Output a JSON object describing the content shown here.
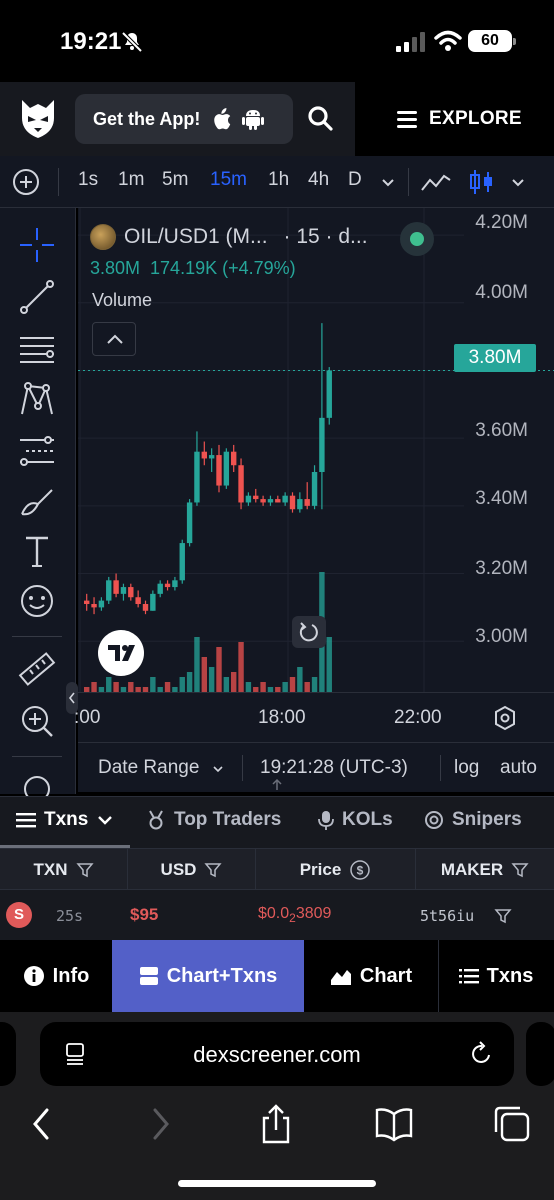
{
  "status_bar": {
    "time": "19:21",
    "battery": "60"
  },
  "header": {
    "get_app_label": "Get the App!",
    "explore_label": "EXPLORE"
  },
  "timeframes": {
    "items": [
      "1s",
      "1m",
      "5m",
      "15m",
      "1h",
      "4h",
      "D"
    ],
    "active": "15m"
  },
  "chart": {
    "symbol": "OIL/USD1 (M...",
    "meta": "· 15 · d...",
    "last_value": "3.80M",
    "change": "174.19K (+4.79%)",
    "volume_label": "Volume",
    "current_price_tag": "3.80M",
    "price_labels": [
      "4.20M",
      "4.00M",
      "3.60M",
      "3.40M",
      "3.20M",
      "3.00M"
    ],
    "time_labels": [
      ":00",
      "18:00",
      "22:00"
    ],
    "colors": {
      "up": "#26a69a",
      "down": "#ef5350",
      "background": "#131722"
    }
  },
  "chart_data": {
    "type": "candlestick",
    "title": "OIL/USD1",
    "ylim": [
      2.85,
      4.28
    ],
    "price_ticks": [
      3.0,
      3.2,
      3.4,
      3.6,
      3.8,
      4.0,
      4.2
    ],
    "time_ticks": [
      ":00",
      "18:00",
      "22:00"
    ],
    "candles": [
      {
        "o": 3.12,
        "h": 3.14,
        "l": 3.09,
        "c": 3.11
      },
      {
        "o": 3.11,
        "h": 3.13,
        "l": 3.08,
        "c": 3.1
      },
      {
        "o": 3.1,
        "h": 3.13,
        "l": 3.09,
        "c": 3.12
      },
      {
        "o": 3.12,
        "h": 3.19,
        "l": 3.11,
        "c": 3.18
      },
      {
        "o": 3.18,
        "h": 3.2,
        "l": 3.13,
        "c": 3.14
      },
      {
        "o": 3.14,
        "h": 3.17,
        "l": 3.12,
        "c": 3.16
      },
      {
        "o": 3.16,
        "h": 3.17,
        "l": 3.12,
        "c": 3.13
      },
      {
        "o": 3.13,
        "h": 3.15,
        "l": 3.1,
        "c": 3.11
      },
      {
        "o": 3.11,
        "h": 3.12,
        "l": 3.08,
        "c": 3.09
      },
      {
        "o": 3.09,
        "h": 3.15,
        "l": 3.09,
        "c": 3.14
      },
      {
        "o": 3.14,
        "h": 3.18,
        "l": 3.13,
        "c": 3.17
      },
      {
        "o": 3.17,
        "h": 3.18,
        "l": 3.15,
        "c": 3.16
      },
      {
        "o": 3.16,
        "h": 3.19,
        "l": 3.15,
        "c": 3.18
      },
      {
        "o": 3.18,
        "h": 3.3,
        "l": 3.17,
        "c": 3.29
      },
      {
        "o": 3.29,
        "h": 3.42,
        "l": 3.28,
        "c": 3.41
      },
      {
        "o": 3.41,
        "h": 3.62,
        "l": 3.4,
        "c": 3.56
      },
      {
        "o": 3.56,
        "h": 3.59,
        "l": 3.52,
        "c": 3.54
      },
      {
        "o": 3.54,
        "h": 3.57,
        "l": 3.5,
        "c": 3.55
      },
      {
        "o": 3.55,
        "h": 3.58,
        "l": 3.44,
        "c": 3.46
      },
      {
        "o": 3.46,
        "h": 3.57,
        "l": 3.45,
        "c": 3.56
      },
      {
        "o": 3.56,
        "h": 3.58,
        "l": 3.5,
        "c": 3.52
      },
      {
        "o": 3.52,
        "h": 3.54,
        "l": 3.39,
        "c": 3.41
      },
      {
        "o": 3.41,
        "h": 3.44,
        "l": 3.4,
        "c": 3.43
      },
      {
        "o": 3.43,
        "h": 3.45,
        "l": 3.41,
        "c": 3.42
      },
      {
        "o": 3.42,
        "h": 3.43,
        "l": 3.4,
        "c": 3.41
      },
      {
        "o": 3.41,
        "h": 3.43,
        "l": 3.4,
        "c": 3.42
      },
      {
        "o": 3.42,
        "h": 3.43,
        "l": 3.41,
        "c": 3.41
      },
      {
        "o": 3.41,
        "h": 3.44,
        "l": 3.4,
        "c": 3.43
      },
      {
        "o": 3.43,
        "h": 3.44,
        "l": 3.38,
        "c": 3.39
      },
      {
        "o": 3.39,
        "h": 3.44,
        "l": 3.38,
        "c": 3.42
      },
      {
        "o": 3.42,
        "h": 3.47,
        "l": 3.39,
        "c": 3.4
      },
      {
        "o": 3.4,
        "h": 3.52,
        "l": 3.39,
        "c": 3.5
      },
      {
        "o": 3.5,
        "h": 3.94,
        "l": 3.39,
        "c": 3.66
      },
      {
        "o": 3.66,
        "h": 3.81,
        "l": 3.64,
        "c": 3.8
      }
    ],
    "volumes": [
      1,
      2,
      1,
      3,
      2,
      1,
      2,
      1,
      1,
      3,
      1,
      2,
      1,
      3,
      4,
      11,
      7,
      5,
      9,
      3,
      4,
      10,
      2,
      1,
      2,
      1,
      1,
      2,
      3,
      5,
      2,
      3,
      24,
      11
    ]
  },
  "date_bar": {
    "date_range": "Date Range",
    "clock": "19:21:28 (UTC-3)",
    "log": "log",
    "auto": "auto"
  },
  "tx_tabs": {
    "txns": "Txns",
    "top_traders": "Top Traders",
    "kols": "KOLs",
    "snipers": "Snipers"
  },
  "table": {
    "headers": {
      "txn": "TXN",
      "usd": "USD",
      "price": "Price",
      "maker": "MAKER"
    },
    "rows": [
      {
        "side": "S",
        "age": "25s",
        "usd": "$95",
        "price_prefix": "$0.0",
        "price_zeros": "2",
        "price_digits": "3809",
        "maker": "5t56iu"
      }
    ]
  },
  "nav_tabs": {
    "info": "Info",
    "chart_txns": "Chart+Txns",
    "chart": "Chart",
    "txns": "Txns"
  },
  "browser": {
    "url": "dexscreener.com"
  }
}
